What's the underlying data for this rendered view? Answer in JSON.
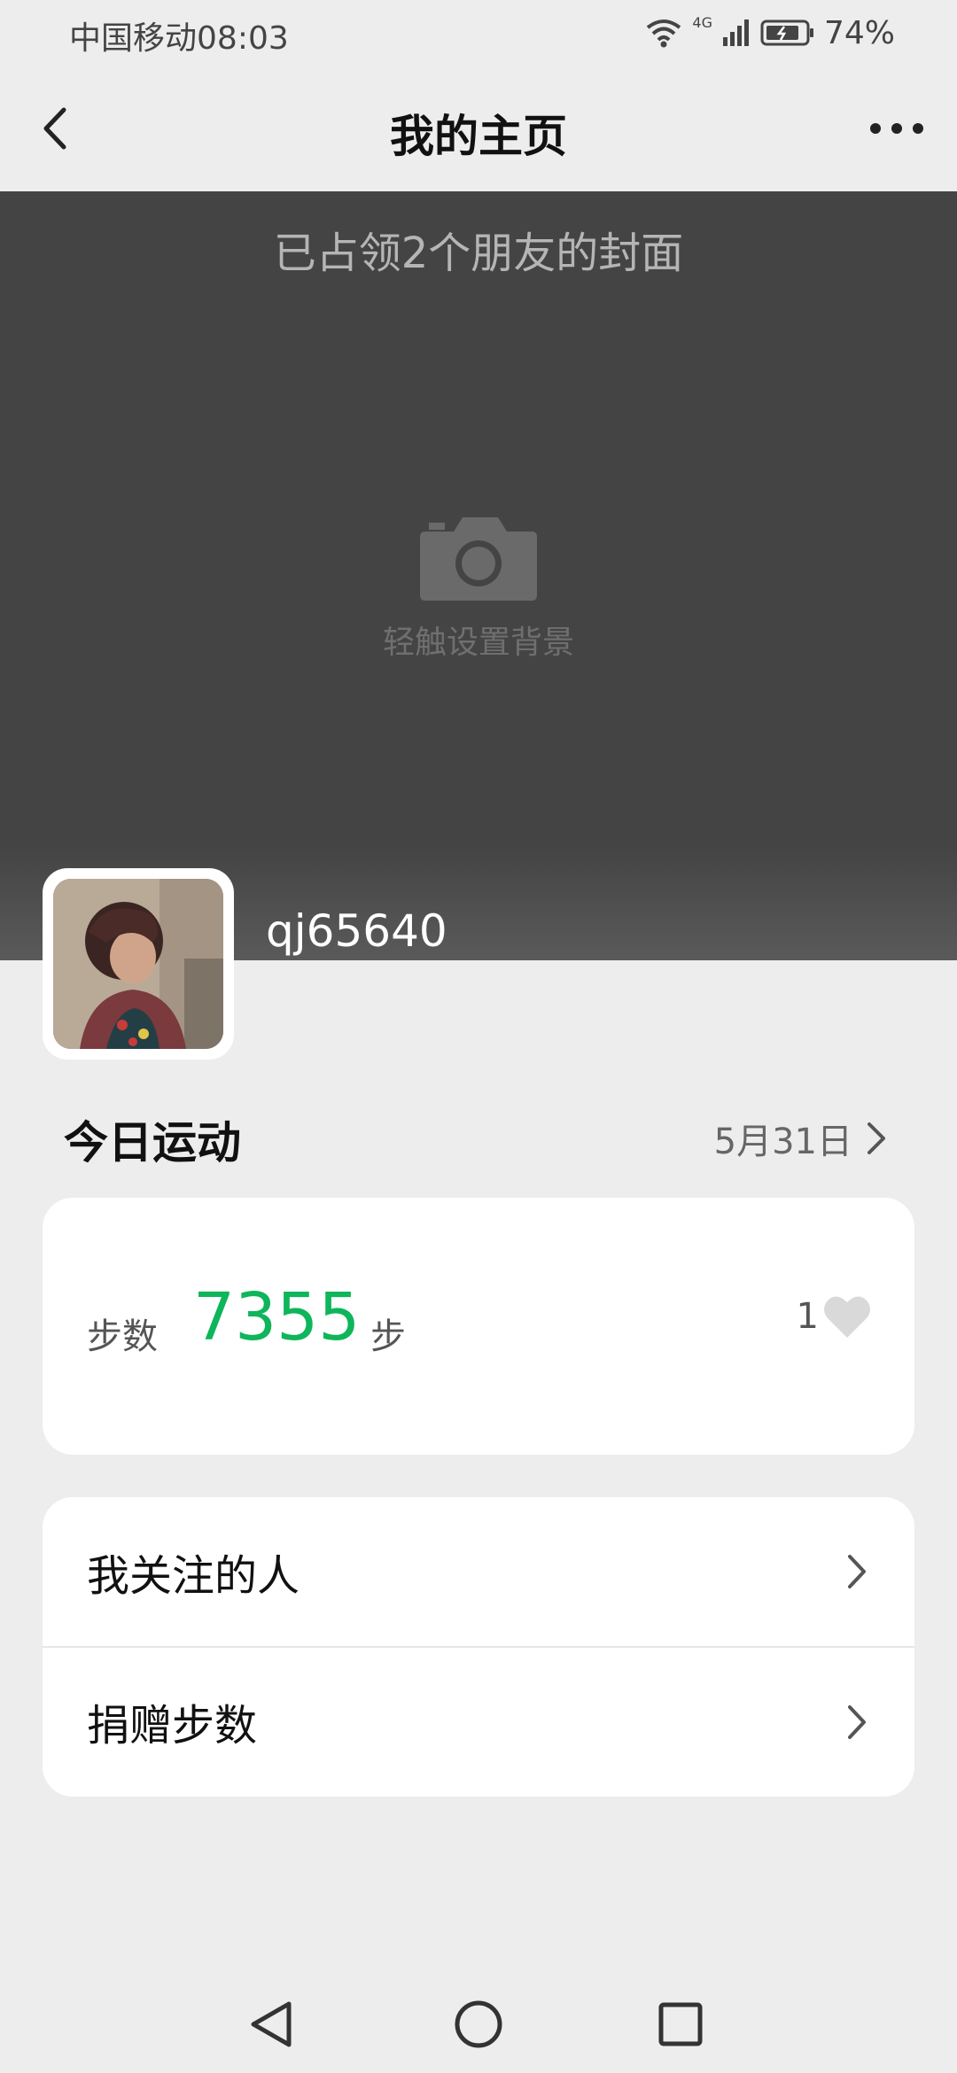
{
  "status_bar": {
    "carrier": "中国移动",
    "time": "08:03",
    "network": "4G",
    "battery": "74%"
  },
  "header": {
    "title": "我的主页"
  },
  "cover": {
    "title": "已占领2个朋友的封面",
    "hint": "轻触设置背景"
  },
  "profile": {
    "username": "qj65640"
  },
  "today": {
    "title": "今日运动",
    "date": "5月31日"
  },
  "steps": {
    "label": "步数",
    "value": "7355",
    "unit": "步",
    "likes": "1"
  },
  "menu": {
    "items": [
      {
        "label": "我关注的人"
      },
      {
        "label": "捐赠步数"
      }
    ]
  },
  "colors": {
    "accent": "#0fb55a",
    "background": "#ededed",
    "cover": "#444444"
  }
}
